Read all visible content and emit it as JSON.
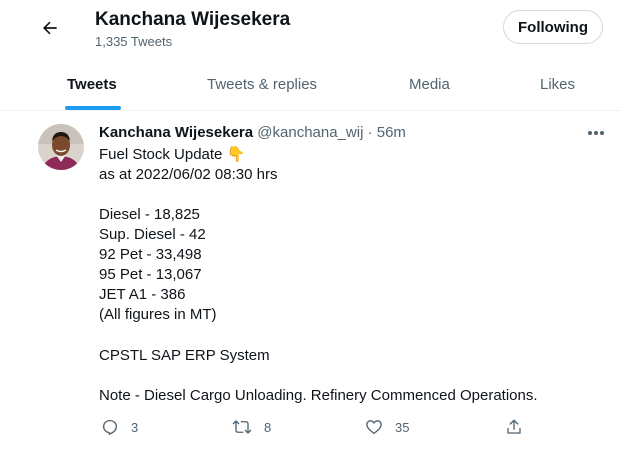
{
  "header": {
    "title": "Kanchana Wijesekera",
    "tweet_count": "1,335 Tweets",
    "follow_button": "Following"
  },
  "tabs": [
    {
      "label": "Tweets",
      "active": true
    },
    {
      "label": "Tweets & replies",
      "active": false
    },
    {
      "label": "Media",
      "active": false
    },
    {
      "label": "Likes",
      "active": false
    }
  ],
  "tweet": {
    "name": "Kanchana Wijesekera",
    "handle": "@kanchana_wij",
    "separator": "·",
    "time": "56m",
    "lines": [
      "Fuel Stock Update",
      "as at 2022/06/02 08:30 hrs",
      "Diesel - 18,825",
      "Sup. Diesel - 42",
      "92 Pet - 33,498",
      "95 Pet - 13,067",
      "JET A1 - 386",
      "(All figures in MT)",
      "CPSTL SAP ERP System",
      "Note - Diesel Cargo Unloading. Refinery Commenced Operations."
    ],
    "emoji": "👇"
  },
  "actions": {
    "replies": "3",
    "retweets": "8",
    "likes": "35"
  },
  "colors": {
    "accent": "#1d9bf0",
    "text": "#0f1419",
    "secondary": "#536471",
    "border": "#eff3f4"
  }
}
